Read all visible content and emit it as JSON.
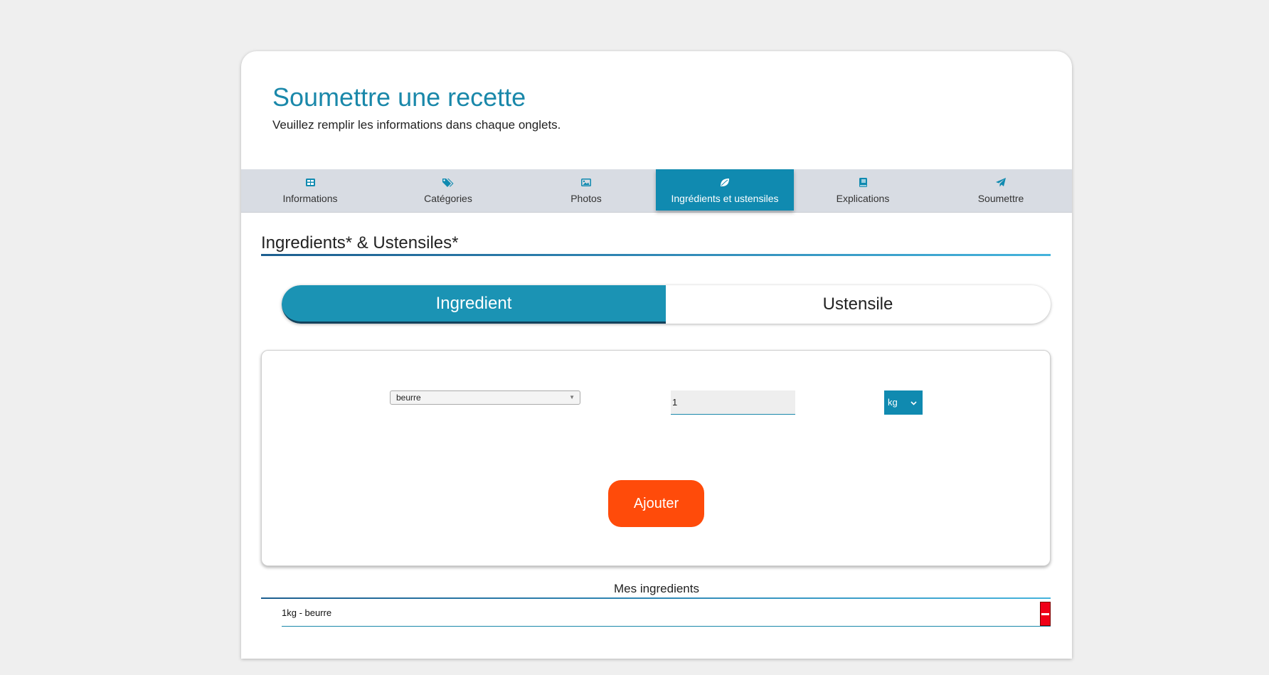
{
  "header": {
    "title": "Soumettre une recette",
    "subtitle": "Veuillez remplir les informations dans chaque onglets."
  },
  "tabs": [
    {
      "label": "Informations",
      "icon": "table-icon"
    },
    {
      "label": "Catégories",
      "icon": "tags-icon"
    },
    {
      "label": "Photos",
      "icon": "image-icon"
    },
    {
      "label": "Ingrédients et ustensiles",
      "icon": "leaf-icon",
      "active": true
    },
    {
      "label": "Explications",
      "icon": "book-icon"
    },
    {
      "label": "Soumettre",
      "icon": "paper-plane-icon"
    }
  ],
  "section": {
    "title": "Ingredients* & Ustensiles*"
  },
  "toggle": {
    "ingredient": "Ingredient",
    "ustensile": "Ustensile"
  },
  "form": {
    "ingredient_value": "beurre",
    "quantity_value": "1",
    "unit_value": "kg",
    "add_label": "Ajouter"
  },
  "list": {
    "title": "Mes ingredients",
    "items": [
      "1kg - beurre"
    ]
  },
  "colors": {
    "accent": "#108ab0",
    "add_button": "#ff4b0a",
    "remove_button": "#f00018",
    "tabbar": "#d8dce3"
  }
}
